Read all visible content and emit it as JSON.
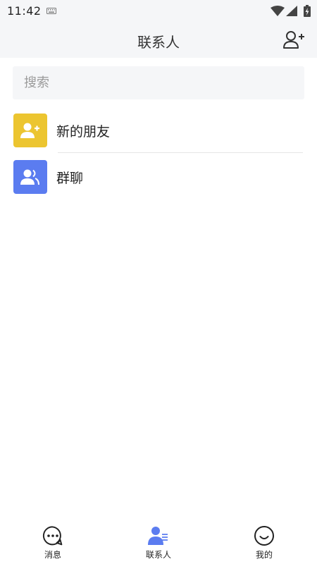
{
  "status_bar": {
    "time": "11:42"
  },
  "header": {
    "title": "联系人",
    "add_contact_icon": "person-add-icon"
  },
  "search": {
    "placeholder": "搜索"
  },
  "contacts_menu": [
    {
      "label": "新的朋友",
      "icon": "person-add-icon",
      "color": "#ecc530"
    },
    {
      "label": "群聊",
      "icon": "group-icon",
      "color": "#5b7cf0"
    }
  ],
  "bottom_nav": {
    "active_color": "#5b7cf0",
    "tabs": [
      {
        "label": "消息",
        "icon": "chat-bubble-icon",
        "active": false
      },
      {
        "label": "联系人",
        "icon": "contacts-icon",
        "active": true
      },
      {
        "label": "我的",
        "icon": "smile-icon",
        "active": false
      }
    ]
  }
}
